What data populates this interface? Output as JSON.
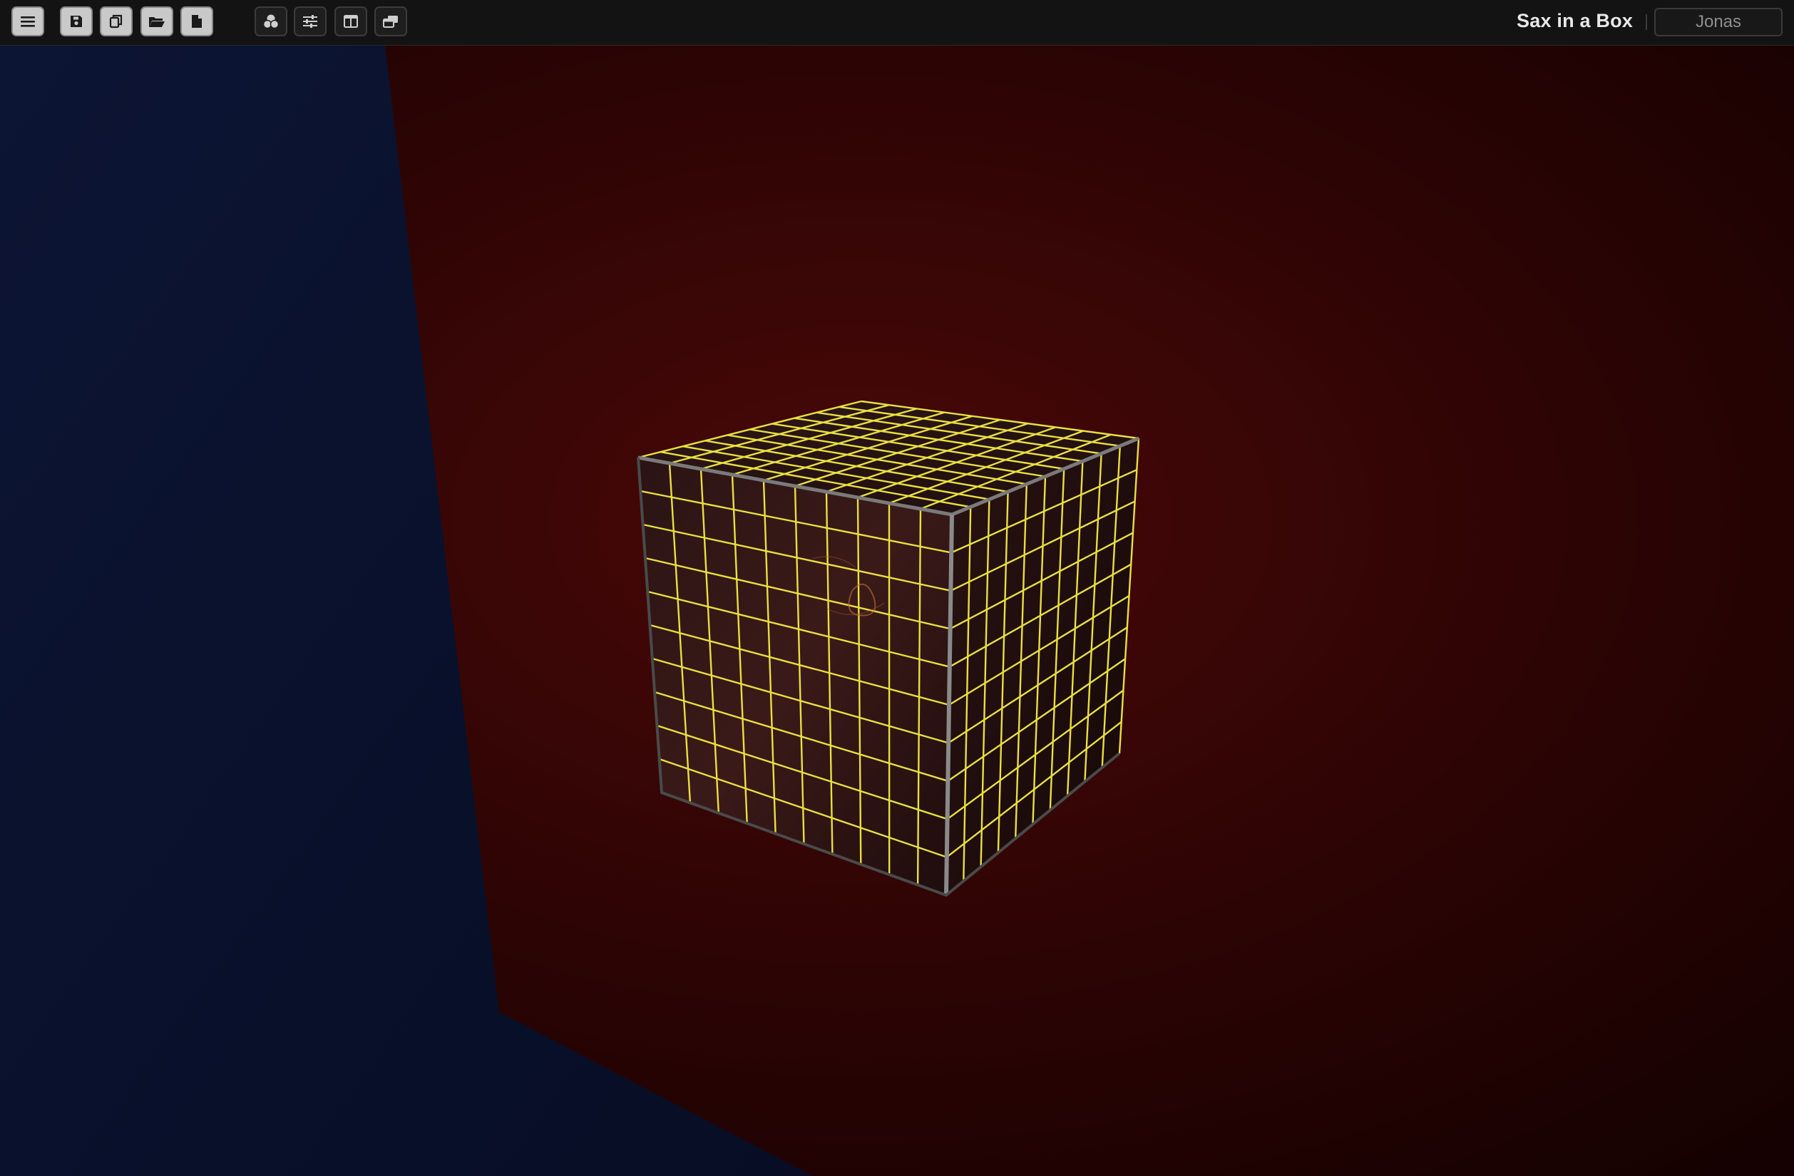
{
  "app": {
    "title": "Sax in a Box",
    "user_name": "Jonas"
  },
  "toolbar": {
    "buttons": [
      {
        "id": "menu",
        "icon": "hamburger-menu-icon",
        "style": "light"
      },
      {
        "id": "save",
        "icon": "save-floppy-icon",
        "style": "light"
      },
      {
        "id": "duplicate",
        "icon": "copy-icon",
        "style": "light"
      },
      {
        "id": "open",
        "icon": "folder-open-icon",
        "style": "light"
      },
      {
        "id": "new",
        "icon": "new-file-icon",
        "style": "light"
      },
      {
        "id": "effects",
        "icon": "effects-circles-icon",
        "style": "dark"
      },
      {
        "id": "settings",
        "icon": "sliders-icon",
        "style": "dark"
      },
      {
        "id": "layout",
        "icon": "panel-layout-icon",
        "style": "dark"
      },
      {
        "id": "windows",
        "icon": "stacked-windows-icon",
        "style": "dark"
      }
    ]
  },
  "scene": {
    "object": "cube",
    "grid_divisions": 10,
    "colors": {
      "left_wall": "#0a1230",
      "back_wall": "#3a0606",
      "floor_shadow": "#1a0202",
      "grid": "#e8e040",
      "cube_face": "#2a1010",
      "cube_edge": "#8a8a8a"
    }
  }
}
